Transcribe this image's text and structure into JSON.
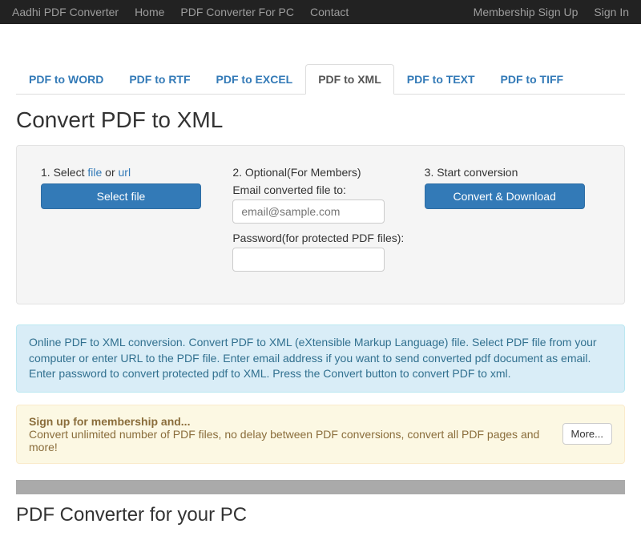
{
  "navbar": {
    "brand": "Aadhi PDF Converter",
    "links": [
      "Home",
      "PDF Converter For PC",
      "Contact"
    ],
    "right": [
      "Membership Sign Up",
      "Sign In"
    ]
  },
  "tabs": [
    {
      "label": "PDF to WORD",
      "active": false
    },
    {
      "label": "PDF to RTF",
      "active": false
    },
    {
      "label": "PDF to EXCEL",
      "active": false
    },
    {
      "label": "PDF to XML",
      "active": true
    },
    {
      "label": "PDF to TEXT",
      "active": false
    },
    {
      "label": "PDF to TIFF",
      "active": false
    }
  ],
  "page_title": "Convert PDF to XML",
  "step1": {
    "prefix": "1. Select ",
    "file_link": "file",
    "mid": " or ",
    "url_link": "url",
    "button": "Select file"
  },
  "step2": {
    "label": "2. Optional(For Members)",
    "email_label": "Email converted file to:",
    "email_placeholder": "email@sample.com",
    "password_label": "Password(for protected PDF files):"
  },
  "step3": {
    "label": "3. Start conversion",
    "button": "Convert & Download"
  },
  "info_text": "Online PDF to XML conversion. Convert PDF to XML (eXtensible Markup Language) file. Select PDF file from your computer or enter URL to the PDF file. Enter email address if you want to send converted pdf document as email. Enter password to convert protected pdf to XML. Press the Convert button to convert PDF to xml.",
  "warning": {
    "lead": "Sign up for membership and...",
    "body": "Convert unlimited number of PDF files, no delay between PDF conversions, convert all PDF pages and more!",
    "more": "More..."
  },
  "pc_title": "PDF Converter for your PC"
}
